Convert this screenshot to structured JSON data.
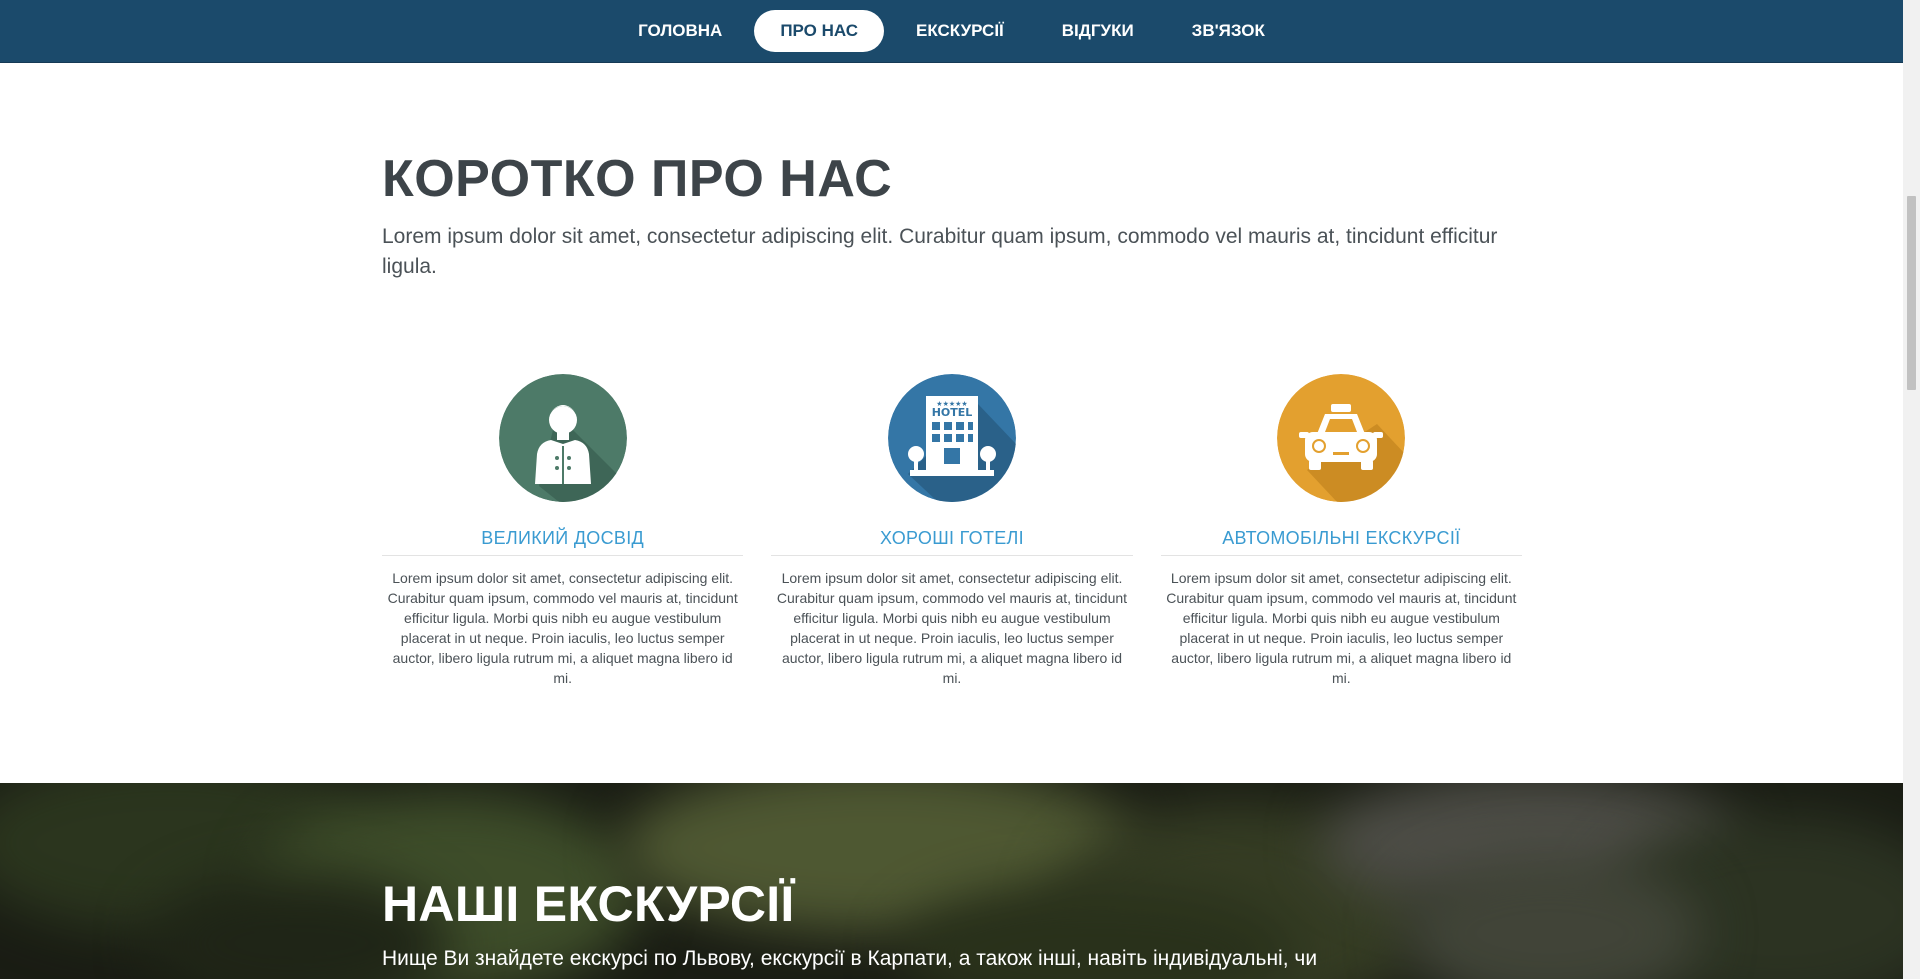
{
  "nav": {
    "items": [
      {
        "label": "ГОЛОВНА",
        "active": false
      },
      {
        "label": "ПРО НАС",
        "active": true
      },
      {
        "label": "ЕКСКУРСІЇ",
        "active": false
      },
      {
        "label": "ВІДГУКИ",
        "active": false
      },
      {
        "label": "ЗВ'ЯЗОК",
        "active": false
      }
    ]
  },
  "about": {
    "title": "КОРОТКО ПРО НАС",
    "lead": "Lorem ipsum dolor sit amet, consectetur adipiscing elit. Curabitur quam ipsum, commodo vel mauris at, tincidunt efficitur ligula."
  },
  "features": [
    {
      "icon": "receptionist-icon",
      "color": "#4d7a68",
      "title": "ВЕЛИКИЙ ДОСВІД",
      "text": "Lorem ipsum dolor sit amet, consectetur adipiscing elit. Curabitur quam ipsum, commodo vel mauris at, tincidunt efficitur ligula. Morbi quis nibh eu augue vestibulum placerat in ut neque. Proin iaculis, leo luctus semper auctor, libero ligula rutrum mi, a aliquet magna libero id mi."
    },
    {
      "icon": "hotel-icon",
      "color": "#3476a6",
      "hotel_sign": "HOTEL",
      "title": "ХОРОШІ ГОТЕЛІ",
      "text": "Lorem ipsum dolor sit amet, consectetur adipiscing elit. Curabitur quam ipsum, commodo vel mauris at, tincidunt efficitur ligula. Morbi quis nibh eu augue vestibulum placerat in ut neque. Proin iaculis, leo luctus semper auctor, libero ligula rutrum mi, a aliquet magna libero id mi."
    },
    {
      "icon": "taxi-icon",
      "color": "#e3a02f",
      "title": "АВТОМОБІЛЬНІ ЕКСКУРСІЇ",
      "text": "Lorem ipsum dolor sit amet, consectetur adipiscing elit. Curabitur quam ipsum, commodo vel mauris at, tincidunt efficitur ligula. Morbi quis nibh eu augue vestibulum placerat in ut neque. Proin iaculis, leo luctus semper auctor, libero ligula rutrum mi, a aliquet magna libero id mi."
    }
  ],
  "tours": {
    "title": "НАШІ ЕКСКУРСІЇ",
    "text": "Нище Ви знайдете екскурсі по Львову, екскурсії в Карпати, а також інші, навіть індивідуальні, чи"
  },
  "colors": {
    "nav_bg": "#1b4a6b",
    "accent": "#3a9bd1",
    "heading": "#3d4449"
  }
}
